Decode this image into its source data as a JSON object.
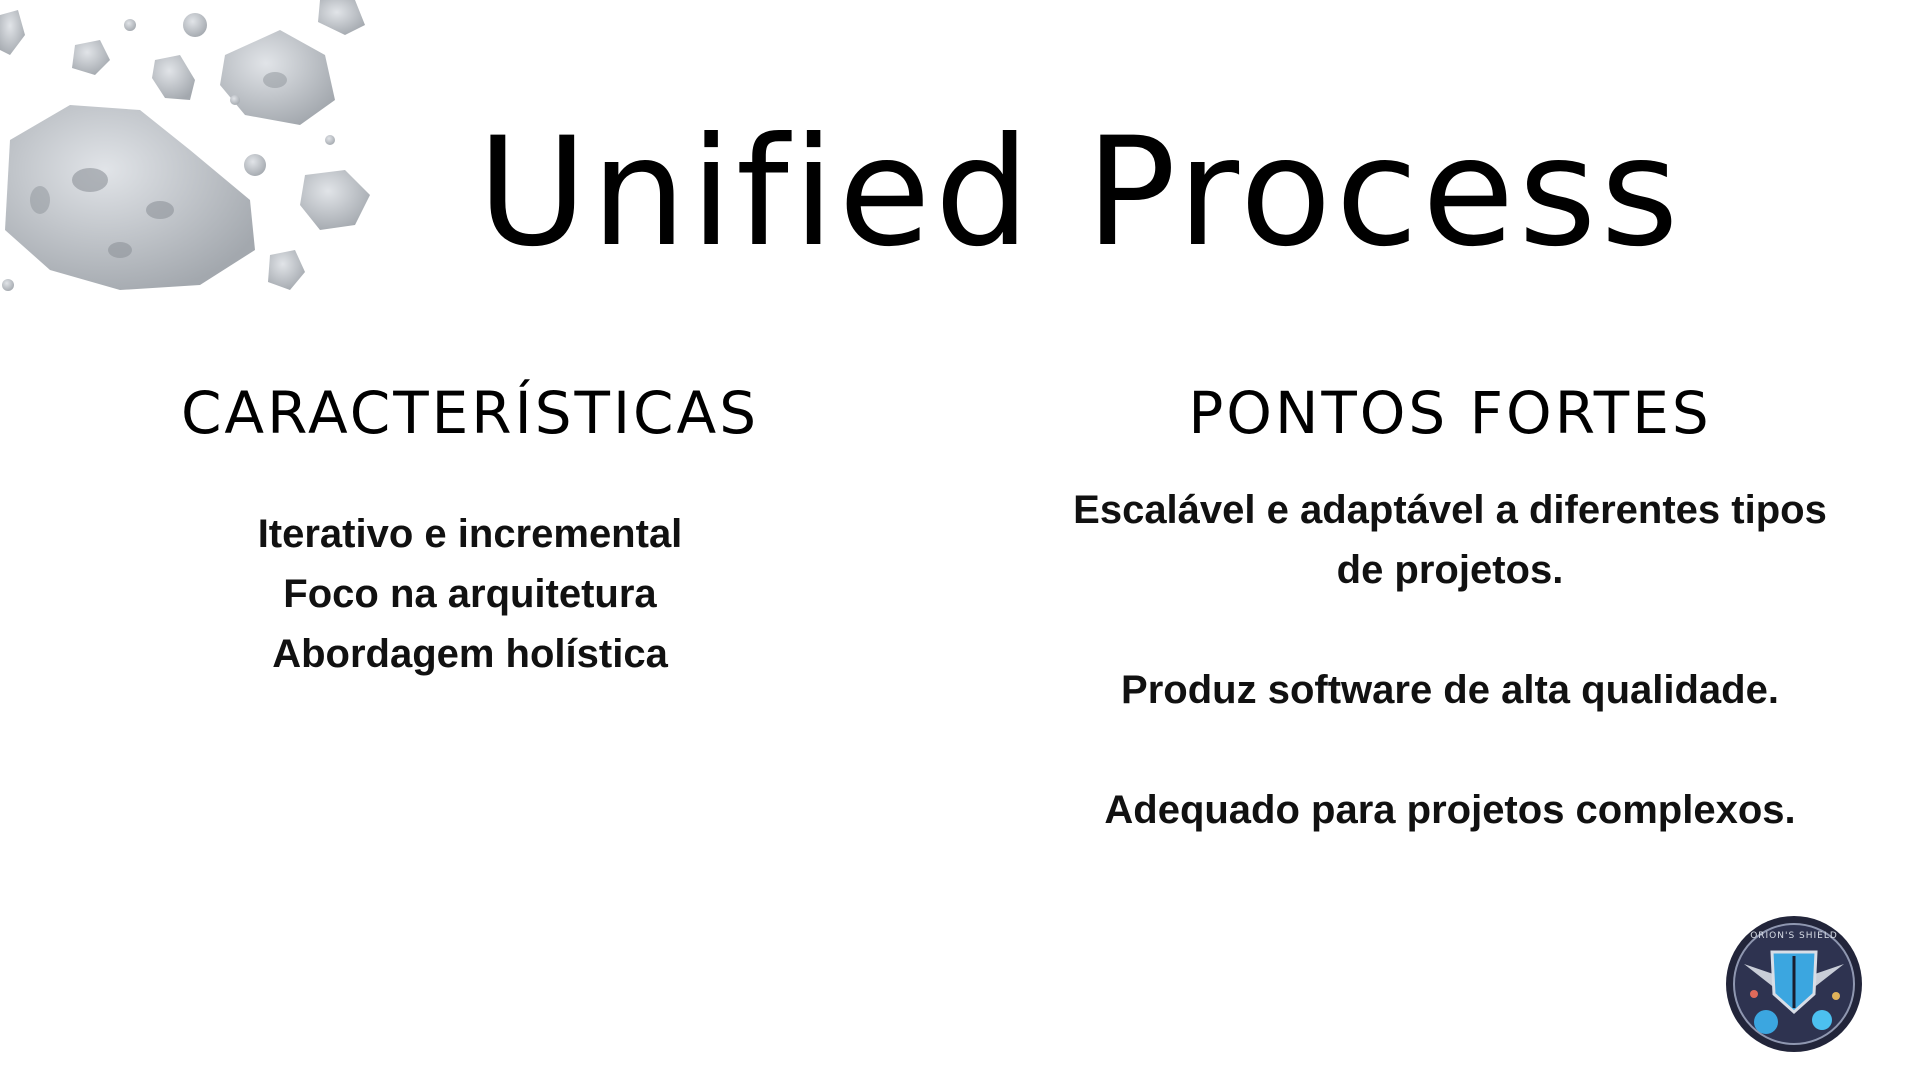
{
  "slide": {
    "title": "Unified Process",
    "left_column": {
      "heading": "CARACTERÍSTICAS",
      "items": [
        "Iterativo e incremental",
        "Foco na arquitetura",
        "Abordagem holística"
      ]
    },
    "right_column": {
      "heading": "PONTOS FORTES",
      "items": [
        "Escalável e adaptável a diferentes tipos de projetos.",
        "Produz software de alta qualidade.",
        "Adequado para projetos complexos."
      ]
    },
    "emblem": {
      "icon": "orions-shield-emblem-icon",
      "text": "ORION'S SHIELD"
    }
  },
  "colors": {
    "text": "#000000",
    "asteroid": "#b8bcc2",
    "emblem_dark": "#22253a",
    "emblem_accent": "#3ba6e0"
  }
}
